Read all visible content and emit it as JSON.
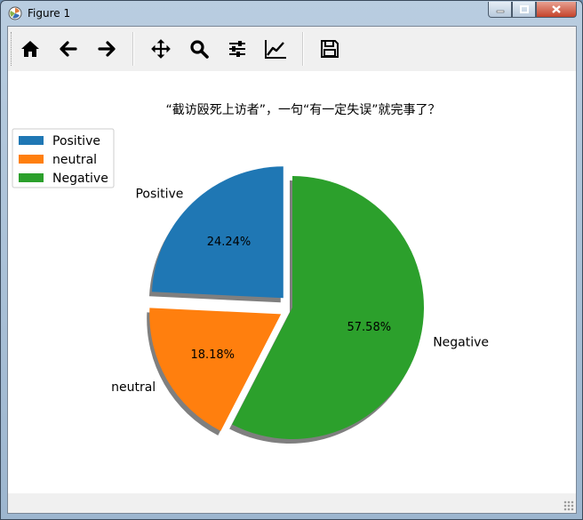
{
  "window": {
    "title": "Figure 1"
  },
  "toolbar": {
    "buttons": [
      {
        "name": "home-button",
        "icon": "home-icon"
      },
      {
        "name": "back-button",
        "icon": "arrow-left-icon"
      },
      {
        "name": "forward-button",
        "icon": "arrow-right-icon"
      },
      {
        "name": "pan-button",
        "icon": "move-icon"
      },
      {
        "name": "zoom-button",
        "icon": "magnifier-icon"
      },
      {
        "name": "subplots-button",
        "icon": "sliders-icon"
      },
      {
        "name": "edit-axes-button",
        "icon": "line-chart-icon"
      },
      {
        "name": "save-button",
        "icon": "floppy-disk-icon"
      }
    ]
  },
  "chart_data": {
    "type": "pie",
    "title": "“截访殴死上访者”，一句“有一定失误”就完事了？",
    "categories": [
      "Positive",
      "neutral",
      "Negative"
    ],
    "values": [
      24.24,
      18.18,
      57.58
    ],
    "value_labels": [
      "24.24%",
      "18.18%",
      "57.58%"
    ],
    "explode": [
      0.1,
      0.1,
      0
    ],
    "colors": [
      "#1f77b4",
      "#ff7f0e",
      "#2ca02c"
    ],
    "start_angle": 90,
    "shadow": true,
    "legend": {
      "placement": "upper-left",
      "entries": [
        "Positive",
        "neutral",
        "Negative"
      ]
    }
  }
}
